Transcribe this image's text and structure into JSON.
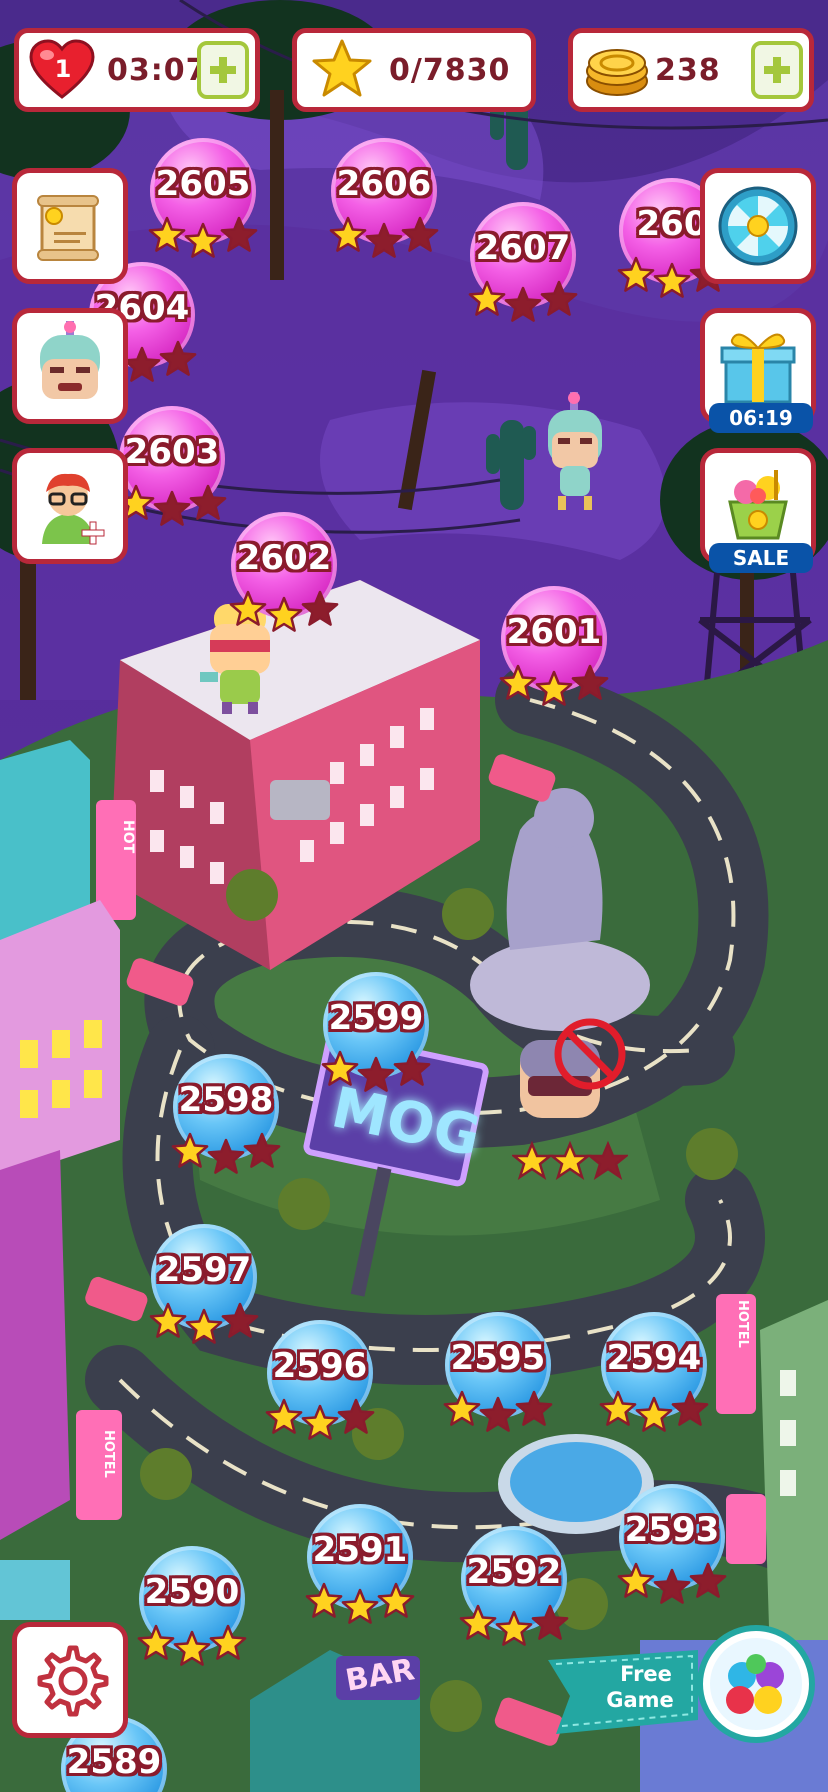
{
  "hud": {
    "lives": "1",
    "life_timer": "03:07",
    "stars": "0/7830",
    "coins": "238"
  },
  "side": {
    "gift_timer": "06:19",
    "shop_badge": "SALE"
  },
  "billboard_text": "MOG",
  "bar_sign": "BAR",
  "hotel_sign": "HOTEL",
  "hot_sign": "HOT",
  "free_game": {
    "line1": "Free",
    "line2": "Game"
  },
  "levels": [
    {
      "n": "2605",
      "c": "pink",
      "s": 2
    },
    {
      "n": "2606",
      "c": "pink",
      "s": 1
    },
    {
      "n": "2607",
      "c": "pink",
      "s": 1
    },
    {
      "n": "260",
      "c": "pink",
      "s": 2
    },
    {
      "n": "2604",
      "c": "pink",
      "s": 0
    },
    {
      "n": "2603",
      "c": "pink",
      "s": 1
    },
    {
      "n": "2602",
      "c": "pink",
      "s": 2
    },
    {
      "n": "2601",
      "c": "pink",
      "s": 2
    },
    {
      "n": "2599",
      "c": "blue",
      "s": 1
    },
    {
      "n": "2598",
      "c": "blue",
      "s": 1
    },
    {
      "n": "2597",
      "c": "blue",
      "s": 2
    },
    {
      "n": "2596",
      "c": "blue",
      "s": 2
    },
    {
      "n": "2595",
      "c": "blue",
      "s": 1
    },
    {
      "n": "2594",
      "c": "blue",
      "s": 2
    },
    {
      "n": "2593",
      "c": "blue",
      "s": 1
    },
    {
      "n": "2592",
      "c": "blue",
      "s": 2
    },
    {
      "n": "2591",
      "c": "blue",
      "s": 3
    },
    {
      "n": "2590",
      "c": "blue",
      "s": 3
    },
    {
      "n": "2589",
      "c": "blue",
      "s": 0
    }
  ],
  "colors": {
    "frame": "#b8283a",
    "star": "#ffd21f",
    "star_empty": "#8d1d2c",
    "pink": "#e944d9",
    "blue": "#3aa8ec"
  }
}
